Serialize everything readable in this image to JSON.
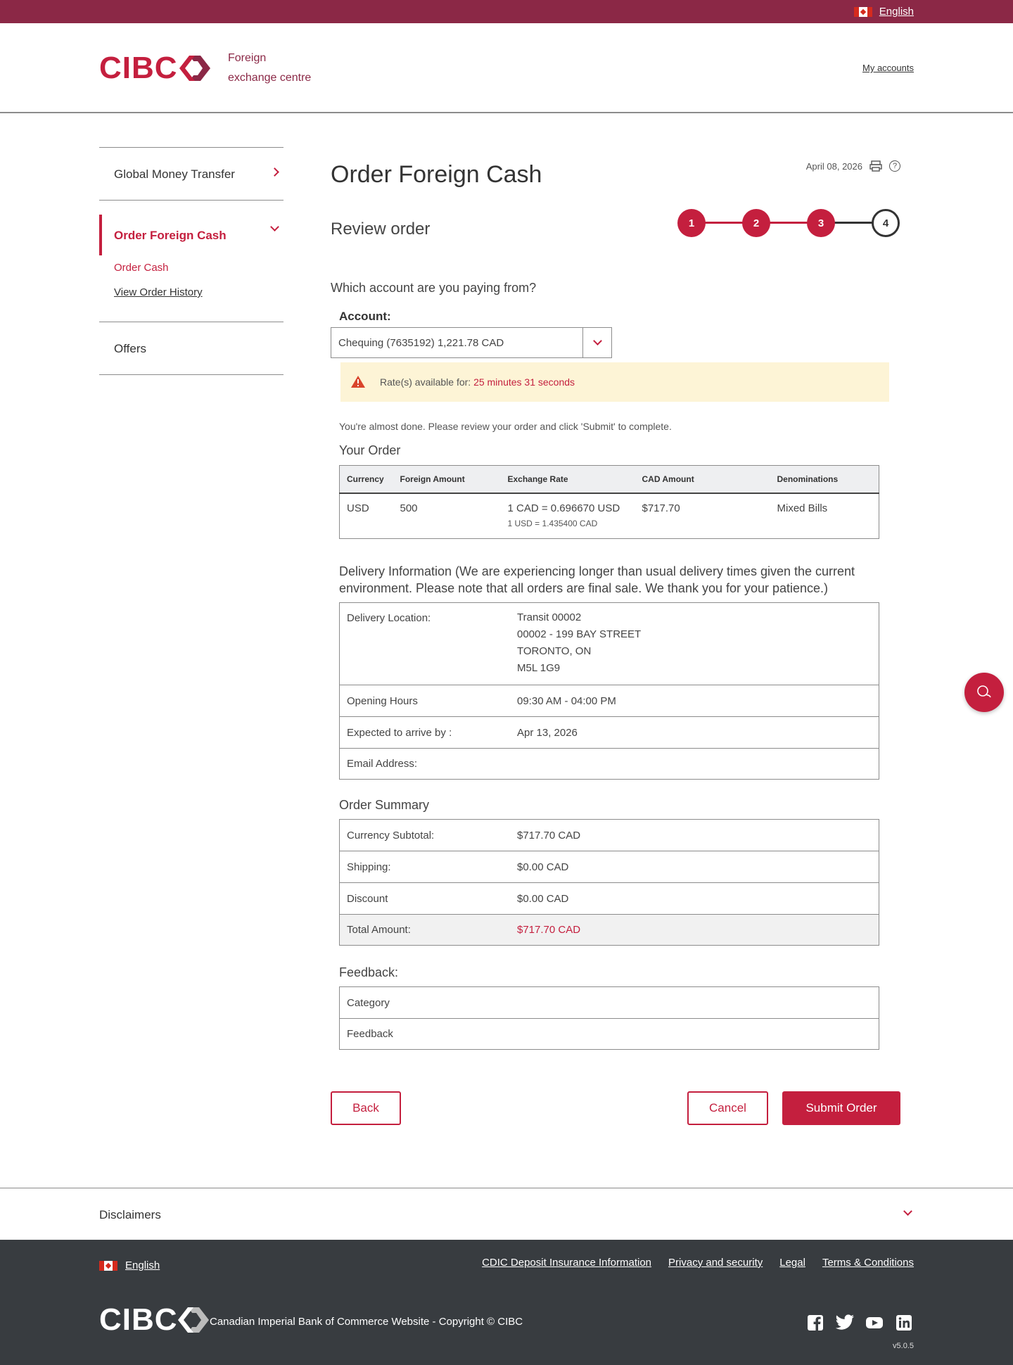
{
  "topbar": {
    "language": "English"
  },
  "header": {
    "logo_text": "CIBC",
    "subbrand_line1": "Foreign",
    "subbrand_line2": "exchange centre",
    "my_accounts": "My accounts"
  },
  "sidenav": {
    "global_money_transfer": "Global Money Transfer",
    "order_foreign_cash": "Order Foreign Cash",
    "order_cash": "Order Cash",
    "view_order_history": "View Order History",
    "offers": "Offers"
  },
  "page": {
    "title": "Order Foreign Cash",
    "date": "April 08, 2026",
    "subtitle": "Review order",
    "steps": [
      "1",
      "2",
      "3",
      "4"
    ],
    "current_step": 4
  },
  "account": {
    "question": "Which account are you paying from?",
    "label": "Account:",
    "selected": "Chequing (7635192) 1,221.78 CAD"
  },
  "alert": {
    "prefix": "Rate(s) available for: ",
    "timer": "25 minutes 31 seconds"
  },
  "review": {
    "almost_done": "You're almost done. Please review your order and click 'Submit' to complete.",
    "your_order_title": "Your Order",
    "columns": [
      "Currency",
      "Foreign Amount",
      "Exchange Rate",
      "CAD Amount",
      "Denominations"
    ],
    "row": {
      "currency": "USD",
      "foreign_amount": "500",
      "rate_main": "1 CAD = 0.696670 USD",
      "rate_inverse": "1 USD = 1.435400 CAD",
      "cad_amount": "$717.70",
      "denominations": "Mixed Bills"
    }
  },
  "delivery": {
    "title": "Delivery Information (We are experiencing longer than usual delivery times given the current environment. Please note that all orders are final sale. We thank you for your patience.)",
    "location_label": "Delivery Location:",
    "location_lines": [
      "Transit 00002",
      "00002 - 199 BAY STREET",
      "TORONTO, ON",
      "M5L 1G9"
    ],
    "hours_label": "Opening Hours",
    "hours": "09:30 AM - 04:00 PM",
    "arrive_label": "Expected to arrive by :",
    "arrive": "Apr 13, 2026",
    "email_label": "Email Address:",
    "email": ""
  },
  "summary": {
    "title": "Order Summary",
    "subtotal_label": "Currency Subtotal:",
    "subtotal": "$717.70 CAD",
    "shipping_label": "Shipping:",
    "shipping": "$0.00 CAD",
    "discount_label": "Discount",
    "discount": "$0.00 CAD",
    "total_label": "Total Amount:",
    "total": "$717.70 CAD"
  },
  "feedback": {
    "title": "Feedback:",
    "category_label": "Category",
    "feedback_label": "Feedback"
  },
  "buttons": {
    "back": "Back",
    "cancel": "Cancel",
    "submit": "Submit Order"
  },
  "disclaimers": {
    "title": "Disclaimers"
  },
  "footer": {
    "language": "English",
    "links": [
      "CDIC Deposit Insurance Information",
      "Privacy and security",
      "Legal",
      "Terms & Conditions"
    ],
    "logo_text": "CIBC",
    "copyright": "Canadian Imperial Bank of Commerce Website - Copyright © CIBC",
    "social": [
      "facebook-icon",
      "twitter-icon",
      "youtube-icon",
      "linkedin-icon"
    ],
    "version": "v5.0.5"
  },
  "colors": {
    "brand_red": "#c41f3e",
    "topbar": "#8b2846",
    "footer": "#383c40",
    "alert_bg": "#fdf4d6"
  }
}
